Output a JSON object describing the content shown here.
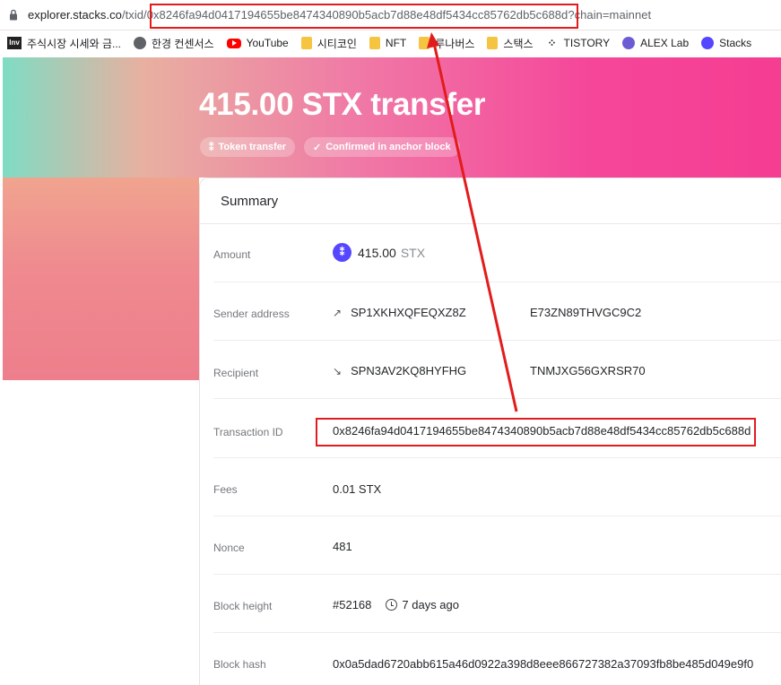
{
  "browser": {
    "url_domain": "explorer.stacks.co",
    "url_path_prefix": "/txid/",
    "url_txid": "0x8246fa94d0417194655be8474340890b5acb7d88e48df5434cc85762db5c688d",
    "url_query": "?chain=mainnet"
  },
  "bookmarks": [
    {
      "label": "주식시장 시세와 금...",
      "icon": "inv-icon"
    },
    {
      "label": "한경 컨센서스",
      "icon": "globe-icon"
    },
    {
      "label": "YouTube",
      "icon": "youtube-icon"
    },
    {
      "label": "시티코인",
      "icon": "folder-icon"
    },
    {
      "label": "NFT",
      "icon": "folder-icon"
    },
    {
      "label": "루나버스",
      "icon": "folder-icon"
    },
    {
      "label": "스택스",
      "icon": "folder-icon"
    },
    {
      "label": "TISTORY",
      "icon": "tistory-icon"
    },
    {
      "label": "ALEX Lab",
      "icon": "alex-icon"
    },
    {
      "label": "Stacks",
      "icon": "stacks-icon"
    }
  ],
  "hero": {
    "title": "415.00 STX transfer",
    "tag_token": "Token transfer",
    "tag_status": "Confirmed in anchor block"
  },
  "summary": {
    "title": "Summary",
    "amount_label": "Amount",
    "amount_value": "415.00",
    "amount_unit": "STX",
    "sender_label": "Sender address",
    "sender_head": "SP1XKHXQFEQXZ8Z",
    "sender_tail": "E73ZN89THVGC9C2",
    "recipient_label": "Recipient",
    "recipient_head": "SPN3AV2KQ8HYFHG",
    "recipient_tail": "TNMJXG56GXRSR70",
    "txid_label": "Transaction ID",
    "txid_value": "0x8246fa94d0417194655be8474340890b5acb7d88e48df5434cc85762db5c688d",
    "fees_label": "Fees",
    "fees_value": "0.01 STX",
    "nonce_label": "Nonce",
    "nonce_value": "481",
    "block_height_label": "Block height",
    "block_height_value": "#52168",
    "block_time": "7 days ago",
    "block_hash_label": "Block hash",
    "block_hash_value": "0x0a5dad6720abb615a46d0922a398d8eee866727382a37093fb8be485d049e9f0"
  },
  "colors": {
    "annotation_red": "#e21c1c",
    "stacks_purple": "#5546ff",
    "hero_pink": "#f5479a",
    "hero_teal": "#7fdcc4"
  }
}
